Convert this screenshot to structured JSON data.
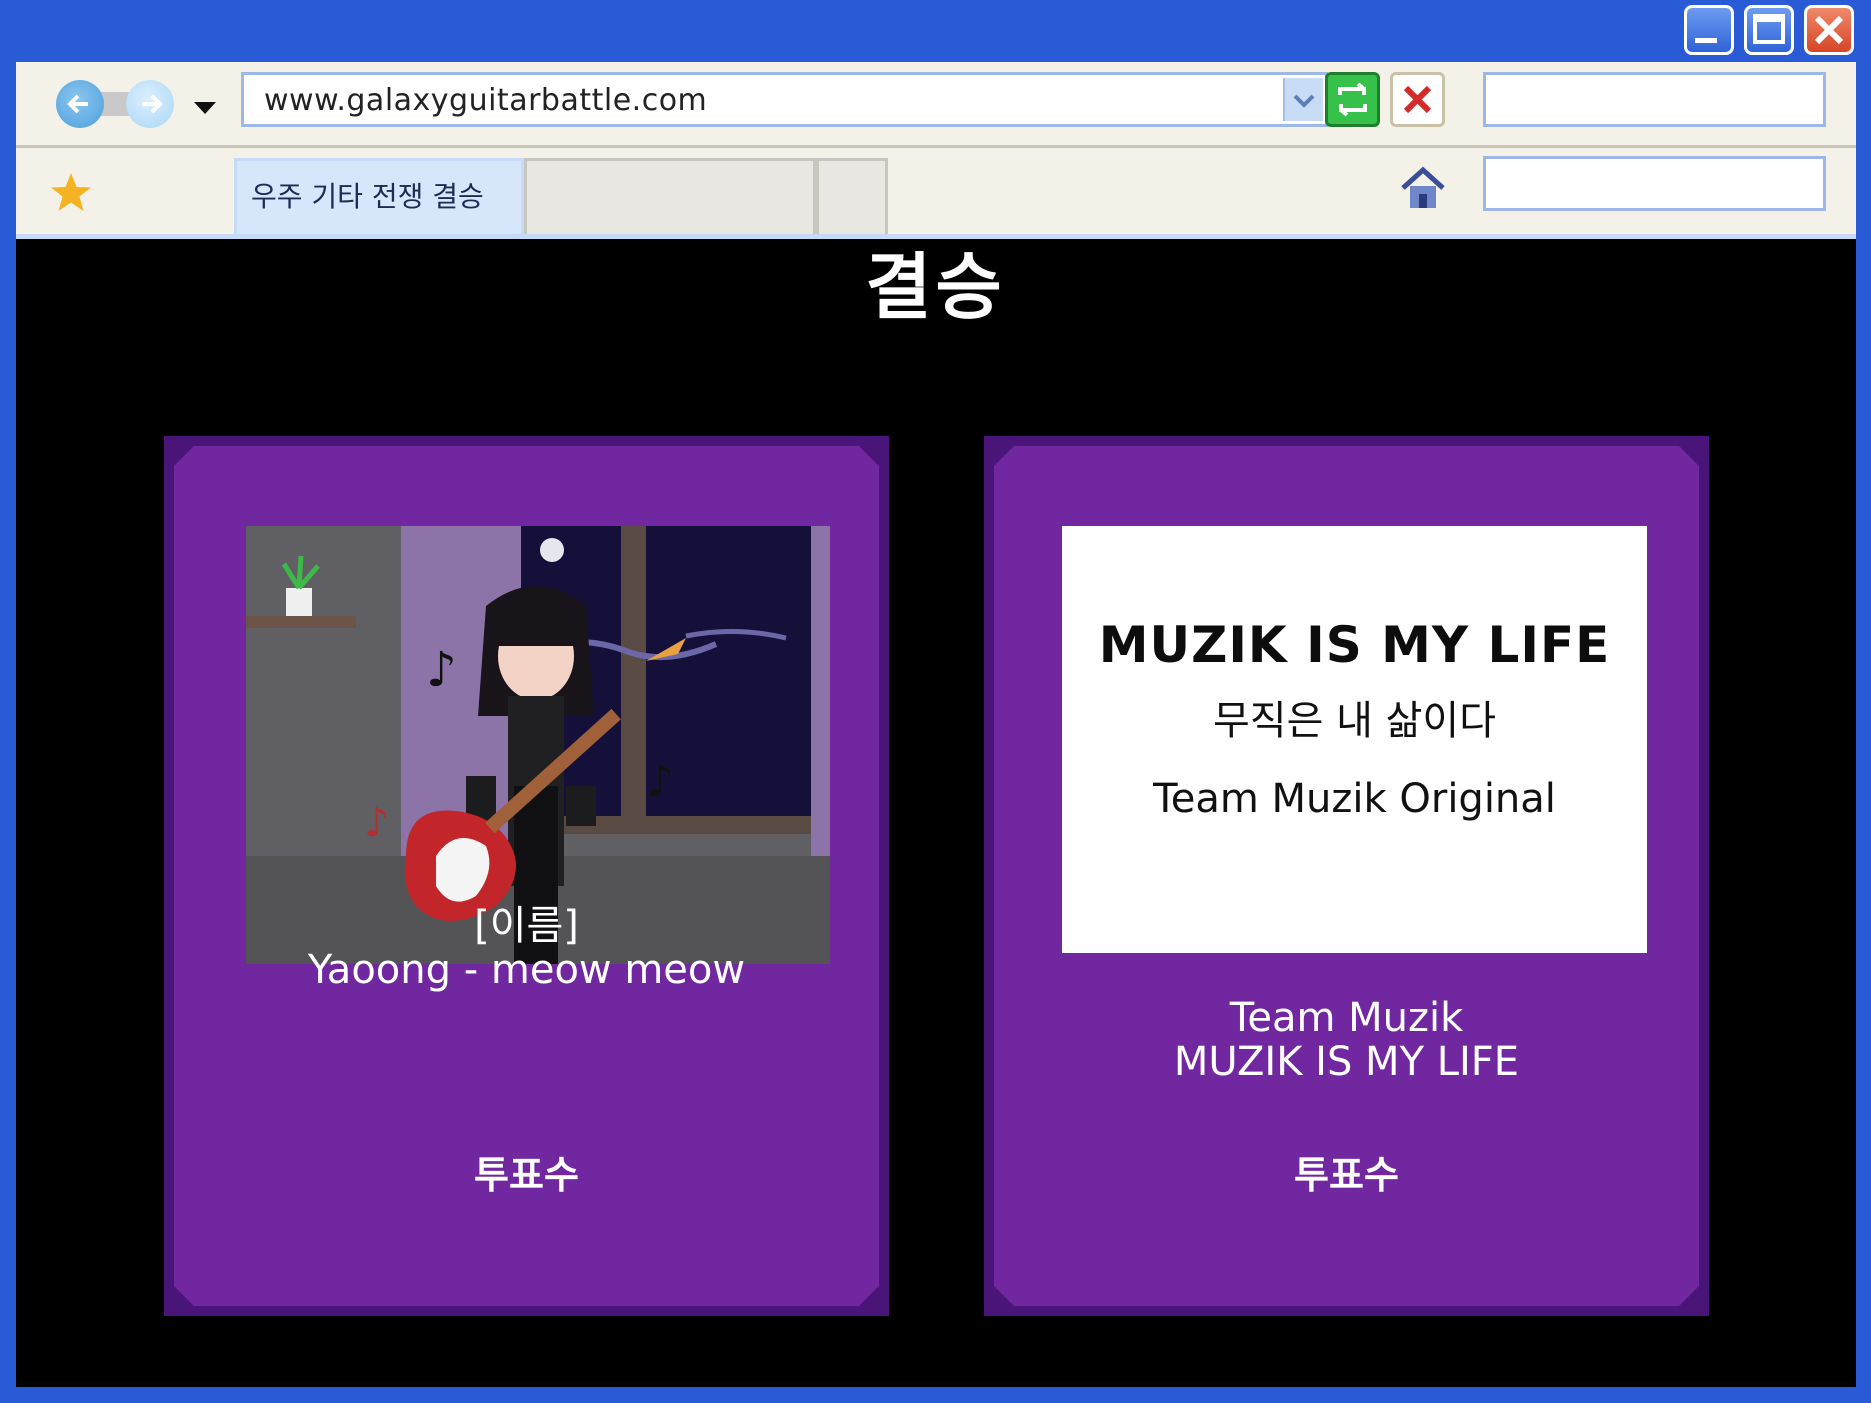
{
  "browser": {
    "url": "www.galaxyguitarbattle.com",
    "tabs": [
      {
        "label": "우주 기타 전쟁 결승"
      },
      {
        "label": ""
      },
      {
        "label": ""
      }
    ],
    "search_value": "",
    "icons": {
      "back": "back-arrow-icon",
      "forward": "forward-arrow-icon",
      "dropdown": "chevron-down-icon",
      "refresh": "refresh-icon",
      "stop": "stop-icon",
      "favorites": "star-icon",
      "home": "home-icon",
      "minimize": "minimize-icon",
      "maximize": "maximize-icon",
      "close": "close-icon"
    }
  },
  "page": {
    "title": "결승",
    "left_entry": {
      "name_label": "[이름]",
      "name": "Yaoong -  meow meow",
      "vote_label": "투표수"
    },
    "right_entry": {
      "cover_title": "MUZIK IS MY LIFE",
      "cover_subtitle": "무직은 내 삶이다",
      "cover_credit": "Team Muzik Original",
      "team": "Team Muzik",
      "song": "MUZIK IS MY LIFE",
      "vote_label": "투표수"
    }
  },
  "colors": {
    "window_frame": "#2a5bd6",
    "page_background": "#000000",
    "card_border": "#4a1578",
    "card_fill": "#7127a0"
  }
}
